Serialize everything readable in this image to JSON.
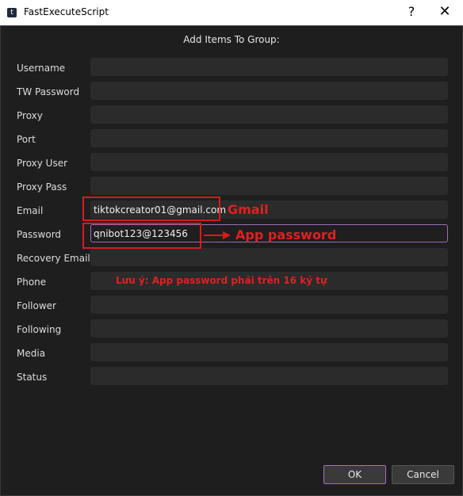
{
  "window": {
    "title": "FastExecuteScript",
    "help_glyph": "?",
    "close_glyph": "✕",
    "icon": "twitter-icon"
  },
  "dialog": {
    "heading": "Add Items To Group:"
  },
  "fields": [
    {
      "label": "Username",
      "value": ""
    },
    {
      "label": "TW Password",
      "value": ""
    },
    {
      "label": "Proxy",
      "value": ""
    },
    {
      "label": "Port",
      "value": ""
    },
    {
      "label": "Proxy User",
      "value": ""
    },
    {
      "label": "Proxy Pass",
      "value": ""
    },
    {
      "label": "Email",
      "value": "tiktokcreator01@gmail.com"
    },
    {
      "label": "Password",
      "value": "qnibot123@123456"
    },
    {
      "label": "Recovery Email",
      "value": ""
    },
    {
      "label": "Phone",
      "value": ""
    },
    {
      "label": "Follower",
      "value": ""
    },
    {
      "label": "Following",
      "value": ""
    },
    {
      "label": "Media",
      "value": ""
    },
    {
      "label": "Status",
      "value": ""
    }
  ],
  "annotations": {
    "gmail": "Gmail",
    "app_password": "App password",
    "note": "Lưu ý: App password phải trên 16 ký tự",
    "color": "#e02020"
  },
  "buttons": {
    "ok": "OK",
    "cancel": "Cancel"
  },
  "colors": {
    "background": "#1e1e1e",
    "field": "#2b2b2b",
    "focus_border": "#9b6bb5"
  }
}
